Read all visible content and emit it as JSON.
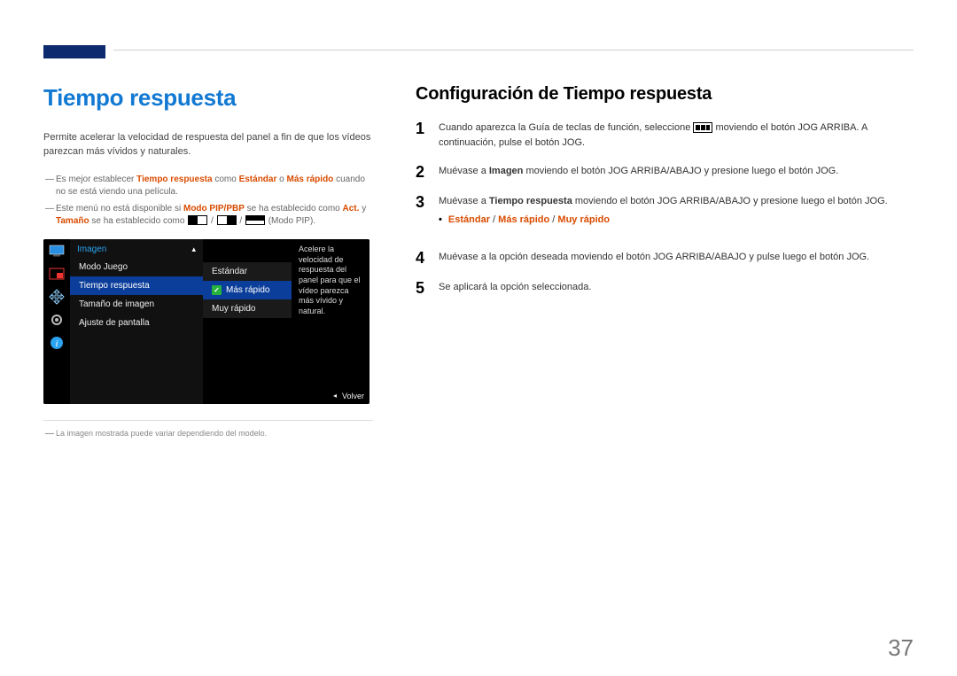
{
  "page_number": "37",
  "left": {
    "heading": "Tiempo respuesta",
    "lead": "Permite acelerar la velocidad de respuesta del panel a fin de que los vídeos parezcan más vívidos y naturales.",
    "note1_pre": "Es mejor establecer ",
    "note1_b1": "Tiempo respuesta",
    "note1_mid1": " como ",
    "note1_b2": "Estándar",
    "note1_mid2": " o ",
    "note1_b3": "Más rápido",
    "note1_post": " cuando no se está viendo una película.",
    "note2_pre": "Este menú no está disponible si ",
    "note2_b1": "Modo PIP/PBP",
    "note2_mid": " se ha establecido como ",
    "note2_b2": "Act.",
    "note2_mid2": " y ",
    "note2_b3": "Tamaño",
    "note2_post1": " se ha establecido como ",
    "note2_tail": " (Modo PIP).",
    "footnote": "La imagen mostrada puede variar dependiendo del modelo."
  },
  "osd": {
    "header": "Imagen",
    "items": [
      "Modo Juego",
      "Tiempo respuesta",
      "Tamaño de imagen",
      "Ajuste de pantalla"
    ],
    "options": [
      "Estándar",
      "Más rápido",
      "Muy rápido"
    ],
    "desc": "Acelere la velocidad de respuesta del panel para que el vídeo parezca más vívido y natural.",
    "back": "Volver"
  },
  "right": {
    "heading": "Configuración de Tiempo respuesta",
    "steps": [
      {
        "num": "1",
        "pre": "Cuando aparezca la Guía de teclas de función, seleccione ",
        "post": " moviendo el botón JOG ARRIBA. A continuación, pulse el botón JOG."
      },
      {
        "num": "2",
        "pre": "Muévase a ",
        "b": "Imagen",
        "post": " moviendo el botón JOG ARRIBA/ABAJO y presione luego el botón JOG."
      },
      {
        "num": "3",
        "pre": "Muévase a ",
        "b": "Tiempo respuesta",
        "post": " moviendo el botón JOG ARRIBA/ABAJO y presione luego el botón JOG."
      },
      {
        "num": "4",
        "text": "Muévase a la opción deseada moviendo el botón JOG ARRIBA/ABAJO y pulse luego el botón JOG."
      },
      {
        "num": "5",
        "text": "Se aplicará la opción seleccionada."
      }
    ],
    "options_line": {
      "b": "•",
      "o1": "Estándar",
      "s": " / ",
      "o2": "Más rápido",
      "o3": "Muy rápido"
    }
  }
}
